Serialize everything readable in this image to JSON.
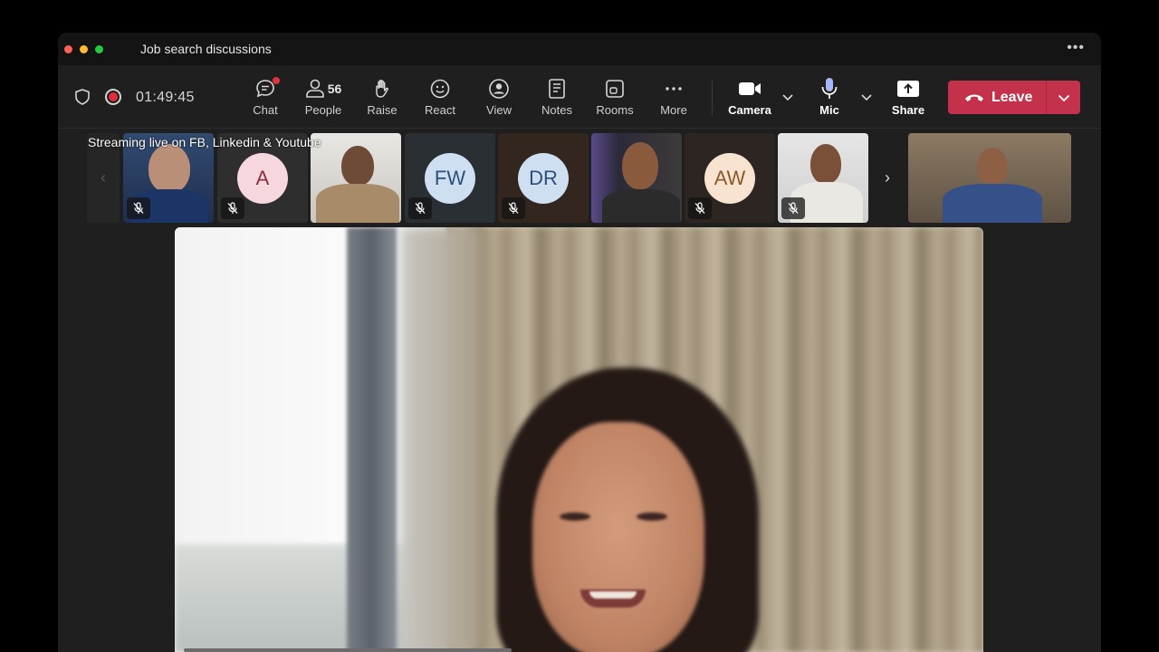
{
  "window": {
    "title": "Job search discussions"
  },
  "toolbar": {
    "timer": "01:49:45",
    "chat": "Chat",
    "people": "People",
    "people_count": "56",
    "raise": "Raise",
    "react": "React",
    "view": "View",
    "notes": "Notes",
    "rooms": "Rooms",
    "more": "More",
    "camera": "Camera",
    "mic": "Mic",
    "share": "Share",
    "leave": "Leave"
  },
  "strip": {
    "stream_label": "Streaming live on FB, Linkedin & Youtube",
    "participants": [
      {
        "kind": "video",
        "muted": true
      },
      {
        "kind": "avatar",
        "initials": "A",
        "muted": true,
        "bg": "#f6d7dd",
        "fg": "#8a2f3f"
      },
      {
        "kind": "video",
        "muted": false
      },
      {
        "kind": "avatar",
        "initials": "FW",
        "muted": true,
        "bg": "#cfdff2",
        "fg": "#2d4f7a"
      },
      {
        "kind": "avatar",
        "initials": "DR",
        "muted": true,
        "bg": "#cfdff2",
        "fg": "#2d4f7a"
      },
      {
        "kind": "video",
        "muted": false
      },
      {
        "kind": "avatar",
        "initials": "AW",
        "muted": true,
        "bg": "#f7e3cf",
        "fg": "#8a5a2b"
      },
      {
        "kind": "video",
        "muted": true
      },
      {
        "kind": "video",
        "muted": false
      }
    ]
  },
  "colors": {
    "leave": "#c4314b",
    "record": "#e02d3c",
    "background": "#1f1f1f"
  }
}
